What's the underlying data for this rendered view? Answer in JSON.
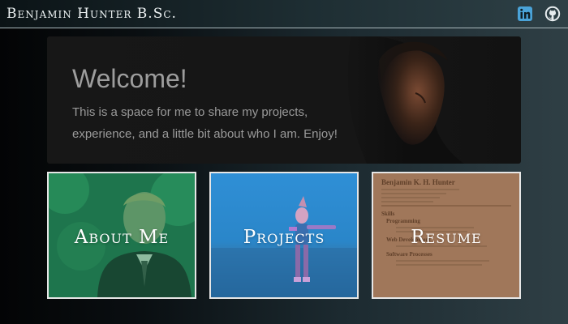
{
  "header": {
    "brand": "Benjamin Hunter B.Sc.",
    "social": [
      {
        "name": "linkedin",
        "icon": "linkedin-icon"
      },
      {
        "name": "github",
        "icon": "github-icon"
      }
    ]
  },
  "hero": {
    "title": "Welcome!",
    "text": "This is a space for me to share my projects, experience, and a little bit about who I am. Enjoy!"
  },
  "cards": [
    {
      "label": "About Me",
      "tint": "#1f8a5c"
    },
    {
      "label": "Projects",
      "tint": "#2f8fd6"
    },
    {
      "label": "Resume",
      "tint": "#a0775a"
    }
  ],
  "resume_preview": {
    "name": "Benjamin K. H. Hunter",
    "sections": [
      "Skills",
      "Programming",
      "Web Development",
      "Software Processes"
    ]
  },
  "colors": {
    "accent_linkedin": "#4aa3d8",
    "border": "#e6e6e6",
    "hero_text": "#9a9a9a"
  }
}
